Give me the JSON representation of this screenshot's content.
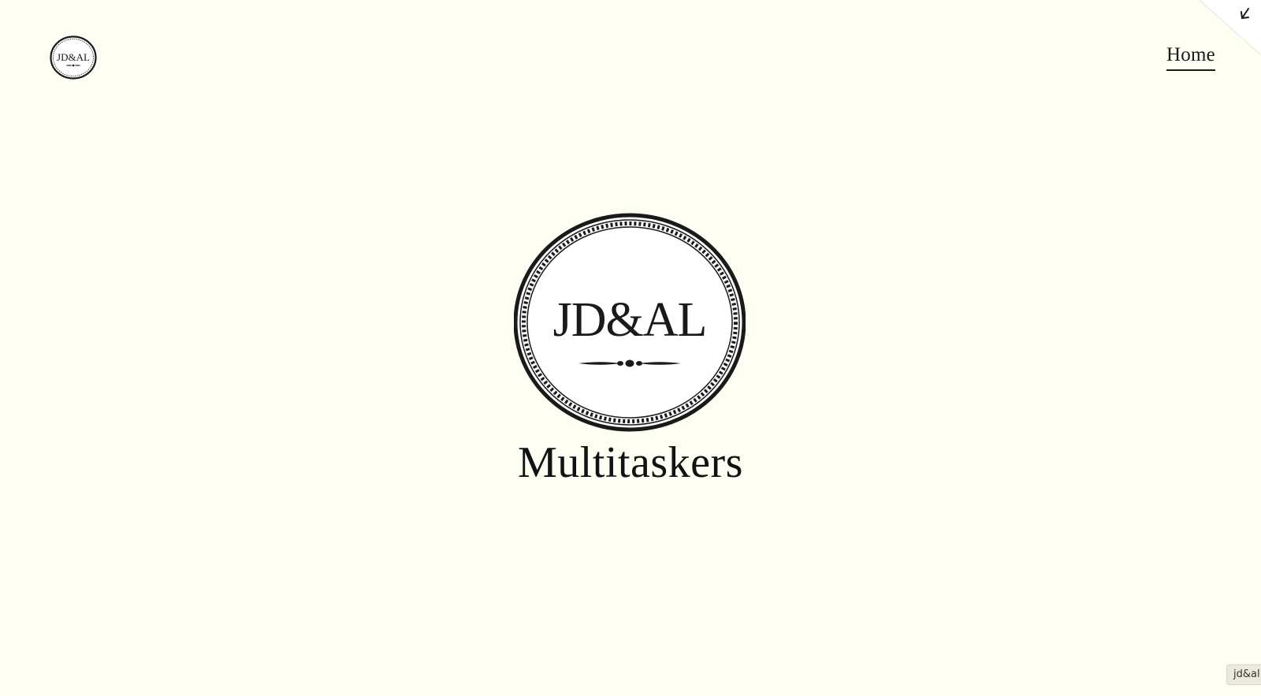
{
  "header": {
    "logo_text": "JD&AL"
  },
  "nav": {
    "home_label": "Home"
  },
  "hero": {
    "emblem_text": "JD&AL",
    "title": "Multitaskers"
  },
  "badge": {
    "label": "jd&al"
  },
  "icons": {
    "corner": "arrow-down-left-icon"
  },
  "colors": {
    "background": "#fefef3",
    "ink": "#141414"
  }
}
